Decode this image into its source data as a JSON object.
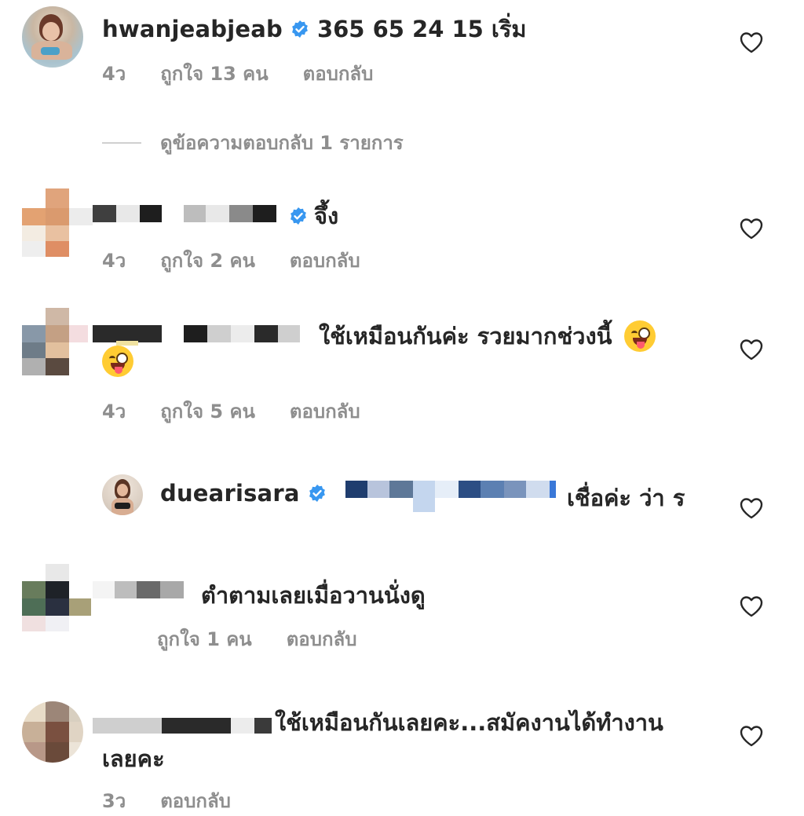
{
  "comments": [
    {
      "username": "hwanjeabjeab",
      "text": "365 65 24 15 เริ่ม",
      "time": "4ว",
      "likes": "ถูกใจ 13 คน",
      "reply": "ตอบกลับ",
      "view_replies": "ดูข้อความตอบกลับ 1 รายการ"
    },
    {
      "text": "จึ้ง",
      "time": "4ว",
      "likes": "ถูกใจ 2 คน",
      "reply": "ตอบกลับ"
    },
    {
      "text": "ใช้เหมือนกันค่ะ รวยมากช่วงนี้",
      "time": "4ว",
      "likes": "ถูกใจ 5 คน",
      "reply": "ตอบกลับ"
    },
    {
      "username": "duearisara",
      "text": "เชื่อค่ะ ว่า ร"
    },
    {
      "text": "ตำตามเลยเมื่อวานนั่งดู",
      "likes": "ถูกใจ 1 คน",
      "reply": "ตอบกลับ"
    },
    {
      "text_line1": "ใช้เหมือนกันเลยคะ...สมัคงานได้ทำงาน",
      "text_line2": "เลยคะ",
      "time": "3ว",
      "reply": "ตอบกลับ"
    }
  ],
  "icons": {
    "like": "heart-outline-icon",
    "verified": "verified-badge-icon",
    "emoji": "winking-face-with-tongue-emoji"
  },
  "colors": {
    "verified": "#3897f0",
    "meta_text": "#8e8e8e",
    "text": "#262626"
  }
}
